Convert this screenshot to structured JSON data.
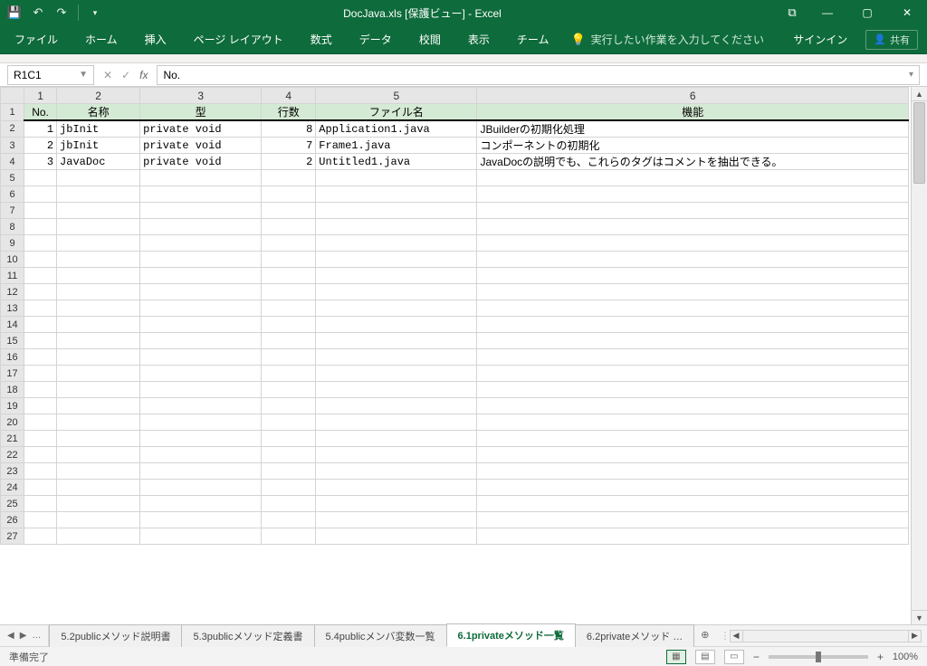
{
  "title": "DocJava.xls  [保護ビュー] - Excel",
  "qat": {
    "save": "save",
    "undo": "undo",
    "redo": "redo"
  },
  "window": {
    "ribbonOptions": "⧉",
    "minimize": "—",
    "maximize": "▢",
    "close": "✕"
  },
  "ribbon": {
    "tabs": [
      "ファイル",
      "ホーム",
      "挿入",
      "ページ レイアウト",
      "数式",
      "データ",
      "校閲",
      "表示",
      "チーム"
    ],
    "tellme": "実行したい作業を入力してください",
    "signin": "サインイン",
    "share": "共有"
  },
  "formula": {
    "nameBox": "R1C1",
    "fxValue": "No."
  },
  "columns": {
    "labels": [
      "1",
      "2",
      "3",
      "4",
      "5",
      "6"
    ]
  },
  "headers": {
    "c1": "No.",
    "c2": "名称",
    "c3": "型",
    "c4": "行数",
    "c5": "ファイル名",
    "c6": "機能"
  },
  "rows": [
    {
      "no": "1",
      "name": "jbInit",
      "type": "private void",
      "lines": "8",
      "file": "Application1.java",
      "func": "JBuilderの初期化処理"
    },
    {
      "no": "2",
      "name": "jbInit",
      "type": "private void",
      "lines": "7",
      "file": "Frame1.java",
      "func": "コンポーネントの初期化"
    },
    {
      "no": "3",
      "name": "JavaDoc",
      "type": "private void",
      "lines": "2",
      "file": "Untitled1.java",
      "func": "JavaDocの説明でも、これらのタグはコメントを抽出できる。"
    }
  ],
  "emptyRowsFrom": 5,
  "emptyRowsTo": 27,
  "sheetTabs": {
    "navPrev": "◀",
    "navNext": "▶",
    "navMore": "…",
    "tabs": [
      {
        "label": "5.2publicメソッド説明書",
        "active": false
      },
      {
        "label": "5.3publicメソッド定義書",
        "active": false
      },
      {
        "label": "5.4publicメンバ変数一覧",
        "active": false
      },
      {
        "label": "6.1privateメソッド一覧",
        "active": true
      },
      {
        "label": "6.2privateメソッド …",
        "active": false
      }
    ],
    "add": "⊕"
  },
  "status": {
    "left": "準備完了",
    "zoom": "100%"
  }
}
